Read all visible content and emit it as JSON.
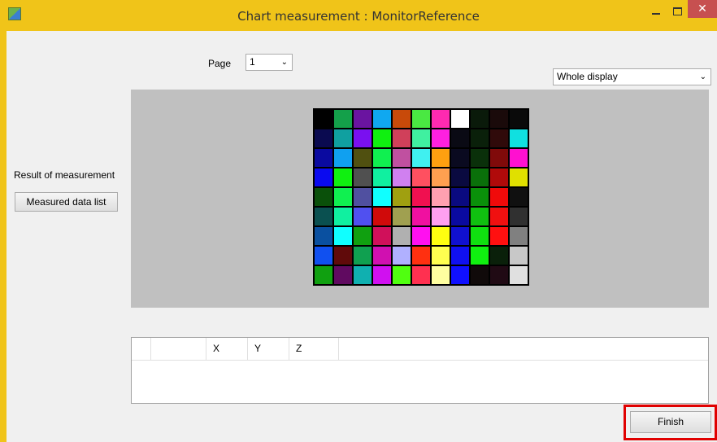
{
  "window": {
    "title": "Chart measurement : MonitorReference",
    "minimize_icon": "minimize-icon",
    "maximize_icon": "maximize-icon",
    "close_glyph": "✕"
  },
  "page": {
    "label": "Page",
    "value": "1"
  },
  "display_select": {
    "value": "Whole display"
  },
  "result_label": "Result of measurement",
  "measured_button": "Measured data list",
  "table": {
    "columns": [
      "",
      "",
      "X",
      "Y",
      "Z",
      ""
    ]
  },
  "finish_button": "Finish",
  "colors": {
    "accent_frame": "#f0c419",
    "highlight": "#e00000",
    "close": "#c75050"
  },
  "chart_patches": [
    [
      "#000000",
      "#14a04a",
      "#6a14a0",
      "#10a8f0",
      "#c84a0a",
      "#4ae842",
      "#ff2ab0",
      "#ffffff",
      "#0a1a0a",
      "#1a0a0a",
      "#0a0a0a"
    ],
    [
      "#0a0a50",
      "#10a0a0",
      "#7a10f0",
      "#10f010",
      "#d0405a",
      "#40f0a0",
      "#ff20e0",
      "#0a0a14",
      "#0a200a",
      "#300a0a",
      "#10e0e0"
    ],
    [
      "#0a0aa0",
      "#10a0f0",
      "#505010",
      "#10f050",
      "#c050a0",
      "#40f0f0",
      "#ffa010",
      "#0a0a20",
      "#0a300a",
      "#800a0a",
      "#ff10d0"
    ],
    [
      "#0a0af0",
      "#10f010",
      "#505050",
      "#10f0a0",
      "#d080f0",
      "#ff5060",
      "#ffa050",
      "#0a0a40",
      "#0a700a",
      "#b00a0a",
      "#e0e000"
    ],
    [
      "#0a500a",
      "#10f050",
      "#5050a0",
      "#10ffff",
      "#a0a010",
      "#f01050",
      "#ffa0b0",
      "#0a0a80",
      "#0a900a",
      "#f00a0a",
      "#101010"
    ],
    [
      "#0a5050",
      "#10f0a0",
      "#5050f0",
      "#d00a0a",
      "#a0a050",
      "#f010a0",
      "#ffa0f0",
      "#0a0aa0",
      "#10c010",
      "#f01010",
      "#303030"
    ],
    [
      "#0a50a0",
      "#10ffff",
      "#10a010",
      "#d0105a",
      "#b0b0b0",
      "#ff10f0",
      "#ffff10",
      "#1010d0",
      "#10e010",
      "#ff1010",
      "#808080"
    ],
    [
      "#1050f0",
      "#600a0a",
      "#10a050",
      "#d010b0",
      "#b0b0ff",
      "#ff3010",
      "#ffff50",
      "#1010f0",
      "#10f010",
      "#0a200a",
      "#c8c8c8"
    ],
    [
      "#10a010",
      "#600a60",
      "#10b0b0",
      "#d010f0",
      "#50ff10",
      "#ff3050",
      "#ffffa0",
      "#1010ff",
      "#100a0a",
      "#200a14",
      "#e0e0e0"
    ]
  ]
}
